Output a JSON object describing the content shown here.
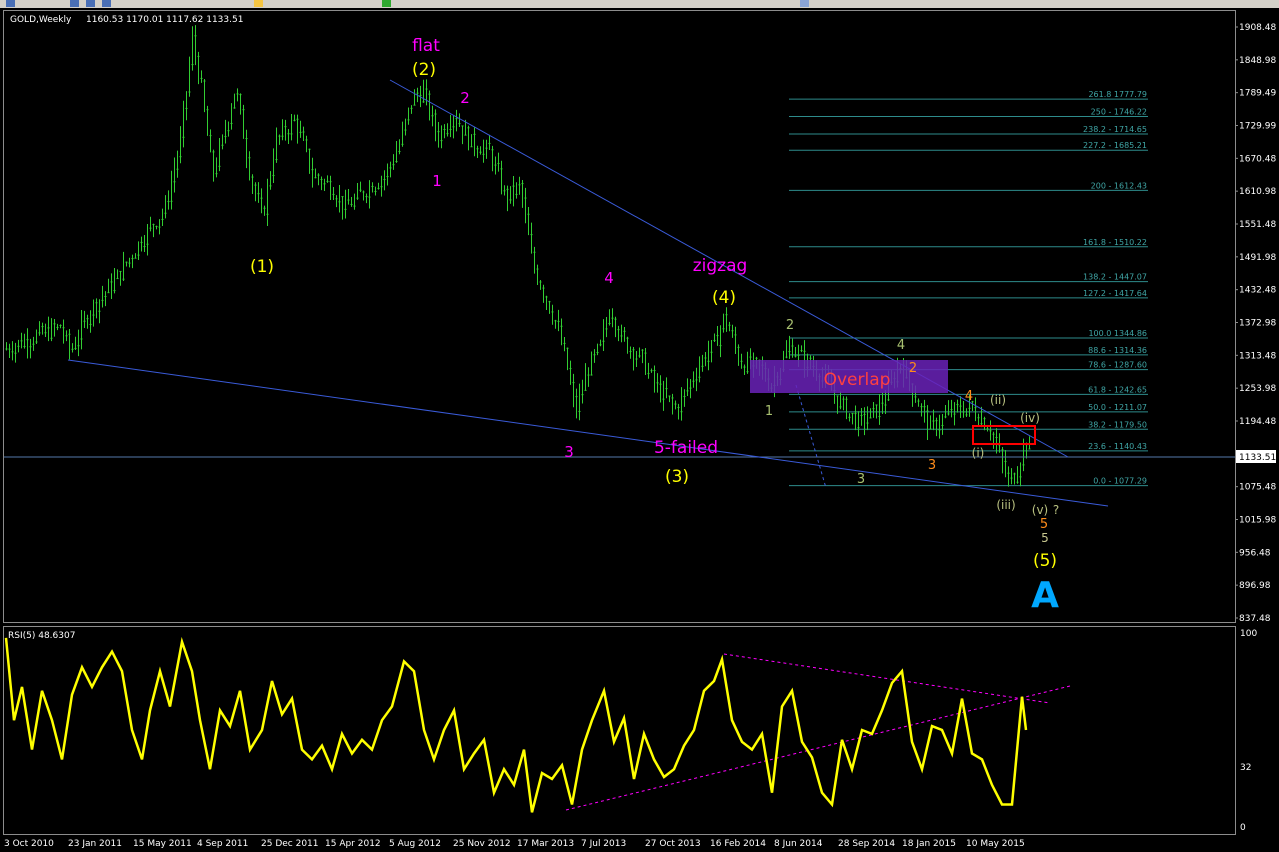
{
  "header": {
    "symbol": "GOLD,Weekly",
    "ohlc": "1160.53 1170.01 1117.62 1133.51"
  },
  "price_axis": {
    "ticks": [
      "1908.48",
      "1848.98",
      "1789.49",
      "1729.99",
      "1670.48",
      "1610.98",
      "1551.48",
      "1491.98",
      "1432.48",
      "1372.98",
      "1313.48",
      "1253.98",
      "1194.48",
      "1134.98",
      "1075.48",
      "1015.98",
      "956.48",
      "896.98",
      "837.48"
    ],
    "current_label": "1133.51",
    "range": [
      837.48,
      1908.48
    ]
  },
  "time_axis": {
    "labels": [
      "3 Oct 2010",
      "23 Jan 2011",
      "15 May 2011",
      "4 Sep 2011",
      "25 Dec 2011",
      "15 Apr 2012",
      "5 Aug 2012",
      "25 Nov 2012",
      "17 Mar 2013",
      "7 Jul 2013",
      "27 Oct 2013",
      "16 Feb 2014",
      "8 Jun 2014",
      "28 Sep 2014",
      "18 Jan 2015",
      "10 May 2015"
    ]
  },
  "fibonacci": {
    "levels": [
      {
        "label": "261.8 1777.79",
        "price": 1777.79
      },
      {
        "label": "250 - 1746.22",
        "price": 1746.22
      },
      {
        "label": "238.2 - 1714.65",
        "price": 1714.65
      },
      {
        "label": "227.2 - 1685.21",
        "price": 1685.21
      },
      {
        "label": "200 - 1612.43",
        "price": 1612.43
      },
      {
        "label": "161.8 - 1510.22",
        "price": 1510.22
      },
      {
        "label": "138.2 - 1447.07",
        "price": 1447.07
      },
      {
        "label": "127.2 - 1417.64",
        "price": 1417.64
      },
      {
        "label": "100.0 1344.86",
        "price": 1344.86
      },
      {
        "label": "88.6 - 1314.36",
        "price": 1314.36
      },
      {
        "label": "78.6 - 1287.60",
        "price": 1287.6
      },
      {
        "label": "61.8 - 1242.65",
        "price": 1242.65
      },
      {
        "label": "50.0 - 1211.07",
        "price": 1211.07
      },
      {
        "label": "38.2 - 1179.50",
        "price": 1179.5
      },
      {
        "label": "23.6 - 1140.43",
        "price": 1140.43
      },
      {
        "label": "0.0 - 1077.29",
        "price": 1077.29
      }
    ]
  },
  "annotations": {
    "flat": "flat",
    "w2": "(2)",
    "w1": "(1)",
    "w3": "(3)",
    "w4": "(4)",
    "w5": "(5)",
    "m1": "1",
    "m2": "2",
    "m3": "3",
    "m4": "4",
    "zigzag": "zigzag",
    "five_failed": "5-failed",
    "overlap": "Overlap",
    "g1": "1",
    "g2": "2",
    "g3": "3",
    "g4": "4",
    "o2": "2",
    "o3": "3",
    "o4": "4",
    "o5": "5",
    "ow5": "5",
    "i": "(i)",
    "ii": "(ii)",
    "iii": "(iii)",
    "iv": "(iv)",
    "v": "(v)",
    "q": "?",
    "big_a": "A"
  },
  "rsi": {
    "title": "RSI(5) 48.6307",
    "ticks": [
      "100",
      "32",
      "0"
    ]
  },
  "colors": {
    "candle": "#32cd32",
    "rsi": "#ffff00",
    "trendline": "#3a5bd9",
    "fib": "#2e8b8b",
    "magenta": "#ff00ff",
    "yellow": "#ffff00",
    "overlap_box": "#7a2cc4",
    "red": "#ff0000",
    "cyan": "#00a8ff"
  },
  "chart_data": {
    "type": "candlestick",
    "title": "GOLD,Weekly",
    "ylim": [
      837.48,
      1908.48
    ],
    "x": [
      "2010-10",
      "2011-01",
      "2011-05",
      "2011-09",
      "2011-12",
      "2012-04",
      "2012-08",
      "2012-11",
      "2013-03",
      "2013-07",
      "2013-10",
      "2014-02",
      "2014-06",
      "2014-09",
      "2015-01",
      "2015-05",
      "2015-07"
    ],
    "close": [
      1340,
      1335,
      1500,
      1780,
      1600,
      1640,
      1720,
      1700,
      1580,
      1290,
      1320,
      1260,
      1320,
      1230,
      1230,
      1180,
      1133.51
    ],
    "rsi_series": {
      "name": "RSI(5)",
      "last": 48.6307,
      "ylim": [
        0,
        100
      ]
    }
  }
}
